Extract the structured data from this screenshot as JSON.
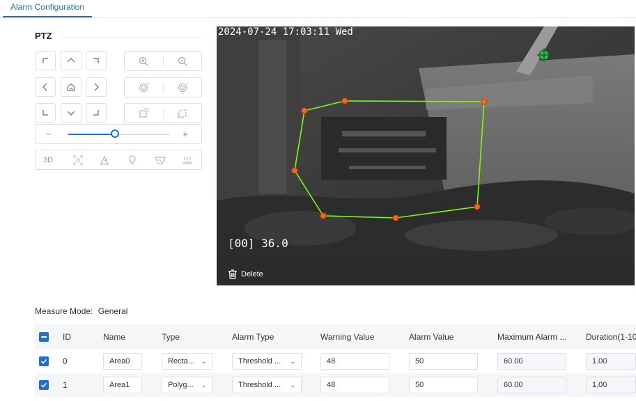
{
  "tabs": [
    {
      "label": "Alarm Configuration",
      "active": true
    }
  ],
  "ptz": {
    "title": "PTZ",
    "zoom_minus": "−",
    "zoom_plus": "+",
    "zoom_level": 0.46,
    "function_buttons": [
      "3D",
      "focus-frame-icon",
      "wiper-icon",
      "light-icon",
      "lens-cover-icon",
      "heater-icon"
    ]
  },
  "video": {
    "timestamp": "2024-07-24 17:03:11 Wed",
    "osd_reading": "[00] 36.0",
    "delete_label": "Delete"
  },
  "measure_mode": {
    "label": "Measure Mode:",
    "value": "General"
  },
  "table": {
    "headers": [
      "ID",
      "Name",
      "Type",
      "Alarm Type",
      "Warning Value",
      "Alarm Value",
      "Maximum Alarm ...",
      "Duration(1-10"
    ],
    "rows": [
      {
        "checked": true,
        "id": "0",
        "name": "Area0",
        "type": "Recta...",
        "alarm_type": "Threshold ...",
        "warning": "48",
        "alarm": "50",
        "max": "60.00",
        "duration": "1.00"
      },
      {
        "checked": true,
        "id": "1",
        "name": "Area1",
        "type": "Polyg...",
        "alarm_type": "Threshold ...",
        "warning": "48",
        "alarm": "50",
        "max": "60.00",
        "duration": "1.00"
      }
    ]
  },
  "colors": {
    "accent": "#1f6fd1",
    "polygon": "#7CFC00",
    "vertex": "#ff6a00"
  }
}
